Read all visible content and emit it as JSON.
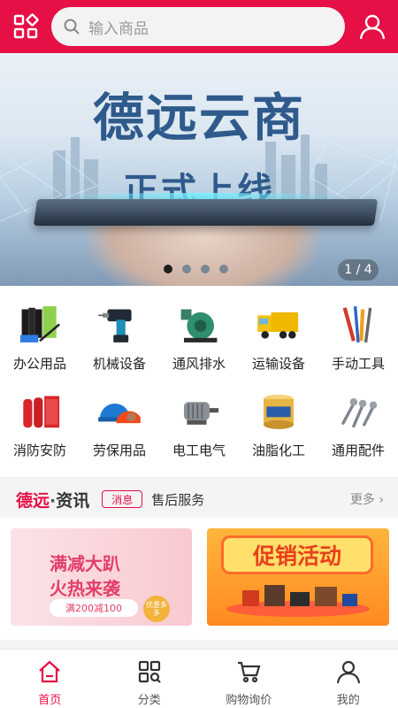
{
  "header": {
    "search_placeholder": "输入商品"
  },
  "banner": {
    "title": "德远云商",
    "subtitle": "正式上线",
    "counter": "1 / 4",
    "slide_count": 4,
    "active_slide": 1
  },
  "categories": [
    {
      "label": "办公用品",
      "icon": "office-supplies-icon"
    },
    {
      "label": "机械设备",
      "icon": "drill-icon"
    },
    {
      "label": "通风排水",
      "icon": "fan-icon"
    },
    {
      "label": "运输设备",
      "icon": "truck-icon"
    },
    {
      "label": "手动工具",
      "icon": "hand-tools-icon"
    },
    {
      "label": "消防安防",
      "icon": "fire-extinguisher-icon"
    },
    {
      "label": "劳保用品",
      "icon": "helmet-icon"
    },
    {
      "label": "电工电气",
      "icon": "motor-icon"
    },
    {
      "label": "油脂化工",
      "icon": "grease-icon"
    },
    {
      "label": "通用配件",
      "icon": "screws-icon"
    }
  ],
  "news": {
    "brand_a": "德远",
    "brand_sep": "·",
    "brand_b": "资讯",
    "tag": "消息",
    "text": "售后服务",
    "more": "更多"
  },
  "promos": {
    "left_line1": "满减大趴",
    "left_line2": "火热来袭",
    "left_line3": "满200减100",
    "left_badge": "优惠多多",
    "right_title": "促销活动"
  },
  "nav": [
    {
      "label": "首页",
      "active": true
    },
    {
      "label": "分类",
      "active": false
    },
    {
      "label": "购物询价",
      "active": false
    },
    {
      "label": "我的",
      "active": false
    }
  ],
  "colors": {
    "brand": "#e60f46",
    "active_nav": "#e60f46"
  }
}
